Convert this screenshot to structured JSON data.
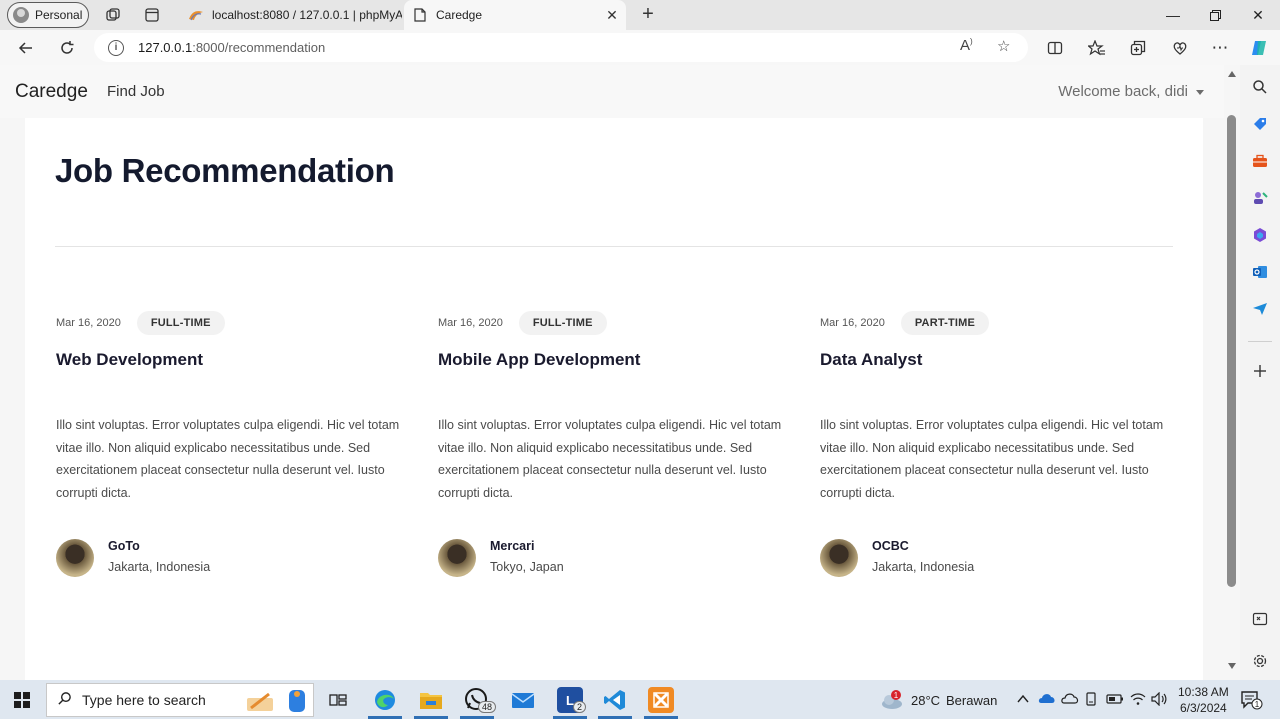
{
  "browser": {
    "profile_label": "Personal",
    "tabs": [
      {
        "title": "localhost:8080 / 127.0.0.1 | phpMyAdmin",
        "favicon": "phpmyadmin-icon"
      },
      {
        "title": "Caredge",
        "favicon": "page-icon"
      }
    ],
    "url_host": "127.0.0.1",
    "url_path": ":8000/recommendation"
  },
  "site": {
    "brand": "Caredge",
    "nav_link": "Find Job",
    "welcome": "Welcome back, didi"
  },
  "page": {
    "title": "Job Recommendation",
    "jobs": [
      {
        "date": "Mar 16, 2020",
        "type": "FULL-TIME",
        "title": "Web Development",
        "description": "Illo sint voluptas. Error voluptates culpa eligendi. Hic vel totam vitae illo. Non aliquid explicabo necessitatibus unde. Sed exercitationem placeat consectetur nulla deserunt vel. Iusto corrupti dicta.",
        "company": "GoTo",
        "location": "Jakarta, Indonesia"
      },
      {
        "date": "Mar 16, 2020",
        "type": "FULL-TIME",
        "title": "Mobile App Development",
        "description": "Illo sint voluptas. Error voluptates culpa eligendi. Hic vel totam vitae illo. Non aliquid explicabo necessitatibus unde. Sed exercitationem placeat consectetur nulla deserunt vel. Iusto corrupti dicta.",
        "company": "Mercari",
        "location": "Tokyo, Japan"
      },
      {
        "date": "Mar 16, 2020",
        "type": "PART-TIME",
        "title": "Data Analyst",
        "description": "Illo sint voluptas. Error voluptates culpa eligendi. Hic vel totam vitae illo. Non aliquid explicabo necessitatibus unde. Sed exercitationem placeat consectetur nulla deserunt vel. Iusto corrupti dicta.",
        "company": "OCBC",
        "location": "Jakarta, Indonesia"
      }
    ]
  },
  "taskbar": {
    "search_placeholder": "Type here to search",
    "whatsapp_badge": "48",
    "app_badge": "2",
    "weather_temp": "28°C",
    "weather_desc": "Berawan",
    "weather_alert": "1",
    "time": "10:38 AM",
    "date": "6/3/2024",
    "notification_count": "1"
  }
}
